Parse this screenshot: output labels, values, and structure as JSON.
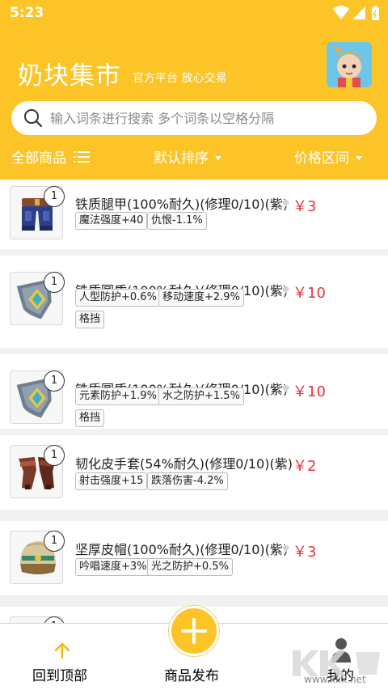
{
  "status_bar": {
    "time": "5:23"
  },
  "header": {
    "title": "奶块集市",
    "subtitle": "官方平台 放心交易",
    "bg_color": "#fcc426"
  },
  "search": {
    "placeholder": "输入词条进行搜索 多个词条以空格分隔",
    "value": ""
  },
  "filters": {
    "all": "全部商品",
    "sort": "默认排序",
    "price": "价格区间"
  },
  "items": [
    {
      "name": "铁质腿甲(100%耐久)(修理0/10)(紫)",
      "price": "￥3",
      "count": "1",
      "icon": "leg-armor-icon",
      "tags": [
        "魔法强度+40",
        "仇恨-1.1%"
      ]
    },
    {
      "name": "铁质圆盾(100%耐久)(修理0/10)(紫)",
      "price": "￥10",
      "count": "1",
      "icon": "round-shield-icon",
      "tags": [
        "人型防护+0.6%",
        "移动速度+2.9%",
        "格挡"
      ]
    },
    {
      "name": "铁质圆盾(100%耐久)(修理0/10)(紫)",
      "price": "￥10",
      "count": "1",
      "icon": "round-shield-icon",
      "tags": [
        "元素防护+1.9%",
        "水之防护+1.5%",
        "格挡"
      ]
    },
    {
      "name": "韧化皮手套(54%耐久)(修理0/10)(紫)",
      "price": "￥2",
      "count": "1",
      "icon": "leather-gloves-icon",
      "tags": [
        "射击强度+15",
        "跌落伤害-4.2%"
      ]
    },
    {
      "name": "坚厚皮帽(100%耐久)(修理0/10)(紫)",
      "price": "￥3",
      "count": "1",
      "icon": "leather-helmet-icon",
      "tags": [
        "吟唱速度+3%",
        "光之防护+0.5%"
      ]
    },
    {
      "count": "1"
    }
  ],
  "bottom_nav": {
    "top": "回到顶部",
    "publish": "商品发布",
    "me": "我的"
  },
  "watermark": {
    "text": "www.kkx.net"
  },
  "colors": {
    "accent": "#fcc426",
    "price": "#e8323c",
    "active_nav": "#f2b705"
  }
}
